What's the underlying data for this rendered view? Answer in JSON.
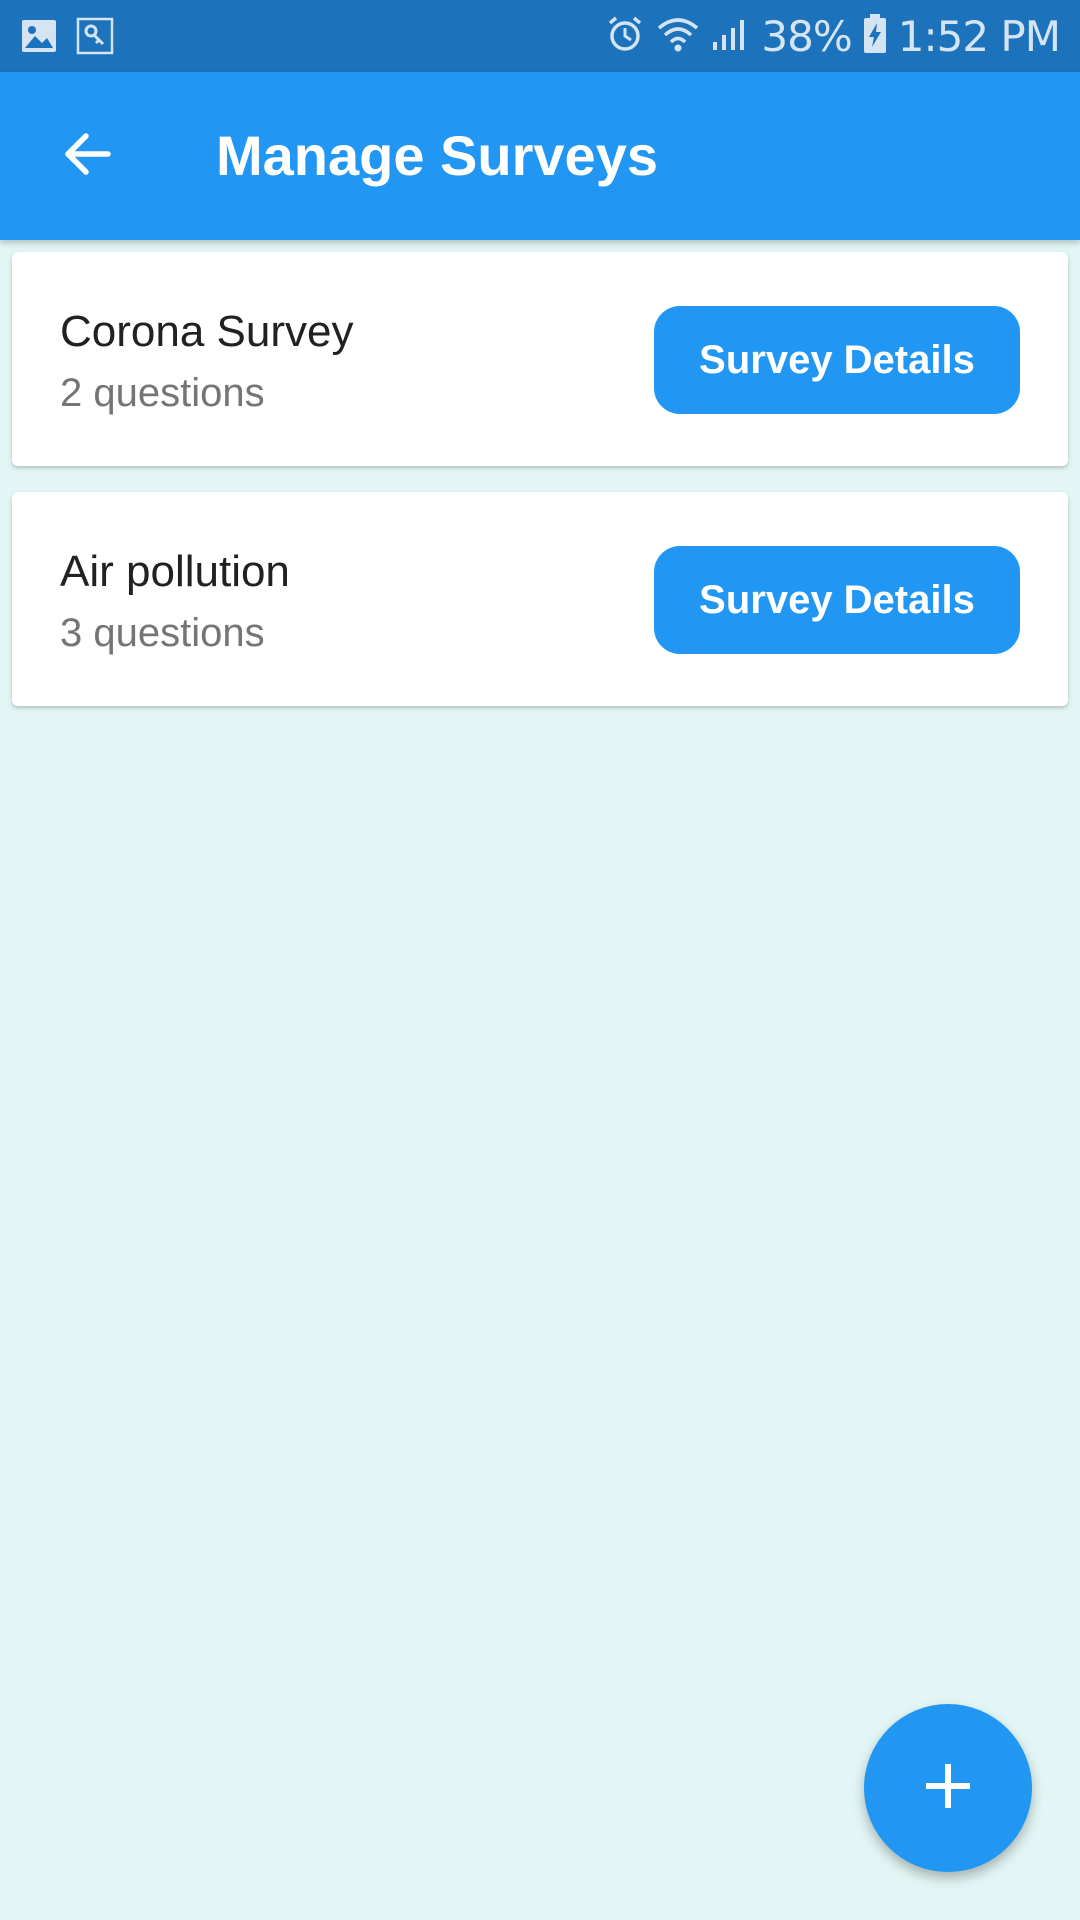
{
  "status_bar": {
    "battery": "38%",
    "time": "1:52 PM",
    "icons": [
      "gallery-icon",
      "key-icon",
      "alarm-icon",
      "wifi-icon",
      "signal-icon",
      "battery-charging-icon"
    ]
  },
  "app_bar": {
    "title": "Manage Surveys",
    "back_icon": "arrow-back-icon"
  },
  "surveys": [
    {
      "name": "Corona Survey",
      "count": "2 questions",
      "button_label": "Survey Details"
    },
    {
      "name": "Air pollution",
      "count": "3 questions",
      "button_label": "Survey Details"
    }
  ],
  "fab": {
    "icon": "plus-icon"
  },
  "colors": {
    "status_bar": "#1c72bb",
    "primary": "#2196f3",
    "background": "#e2f6f5",
    "card": "#ffffff",
    "title_text": "#212121",
    "secondary_text": "#757575"
  }
}
